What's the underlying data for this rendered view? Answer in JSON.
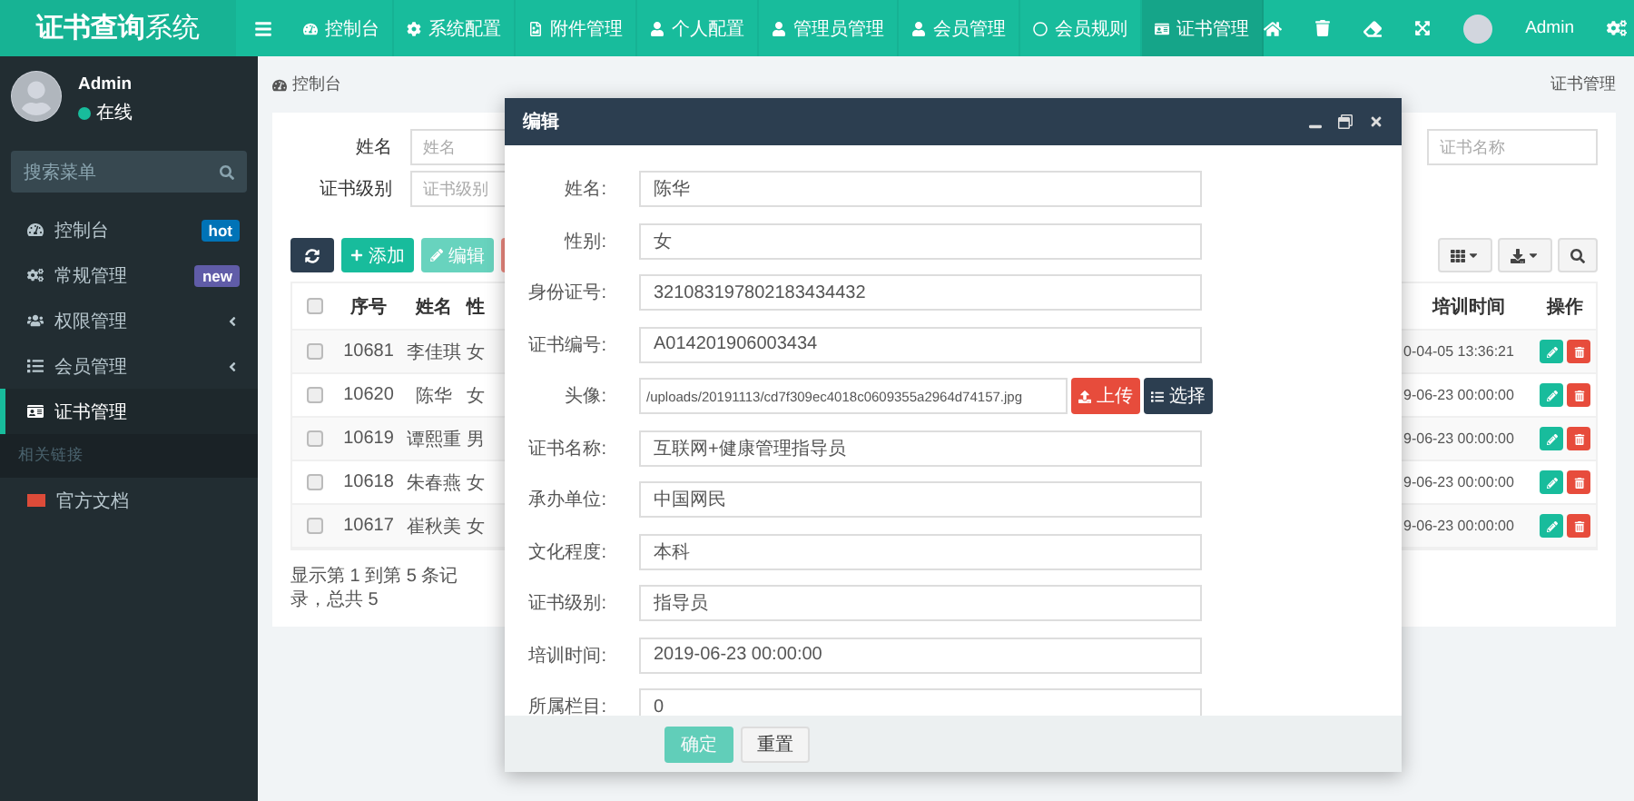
{
  "logo": {
    "bold": "证书查询",
    "light": "系统"
  },
  "topnav": {
    "items": [
      {
        "label": "控制台",
        "selected": false
      },
      {
        "label": "系统配置",
        "selected": false
      },
      {
        "label": "附件管理",
        "selected": false
      },
      {
        "label": "个人配置",
        "selected": false
      },
      {
        "label": "管理员管理",
        "selected": false
      },
      {
        "label": "会员管理",
        "selected": false
      },
      {
        "label": "会员规则",
        "selected": false
      },
      {
        "label": "证书管理",
        "selected": true
      }
    ],
    "user": "Admin"
  },
  "sidebar": {
    "user": {
      "name": "Admin",
      "status": "在线"
    },
    "search": {
      "placeholder": "搜索菜单"
    },
    "items": [
      {
        "label": "控制台",
        "badge": "hot",
        "color": "#0073b7",
        "expandable": false,
        "selected": false
      },
      {
        "label": "常规管理",
        "badge": "new",
        "color": "#605ca8",
        "expandable": false,
        "selected": false
      },
      {
        "label": "权限管理",
        "expandable": true,
        "selected": false
      },
      {
        "label": "会员管理",
        "expandable": true,
        "selected": false
      },
      {
        "label": "证书管理",
        "expandable": false,
        "selected": true
      }
    ],
    "section": "相关链接",
    "links": [
      {
        "label": "官方文档"
      }
    ]
  },
  "breadcrumb": {
    "current": "控制台",
    "right": "证书管理"
  },
  "filters": [
    {
      "label": "姓名",
      "placeholder": "姓名"
    },
    {
      "label": "证书级别",
      "placeholder": "证书级别"
    }
  ],
  "filter_right": {
    "placeholder": "证书名称"
  },
  "toolbar": {
    "buttons": [
      {
        "kind": "refresh",
        "disabled": false
      },
      {
        "kind": "add",
        "label": "添加",
        "disabled": false
      },
      {
        "kind": "edit",
        "label": "编辑",
        "disabled": true
      },
      {
        "kind": "delete",
        "disabled": true
      }
    ]
  },
  "table": {
    "columns": [
      "序号",
      "姓名",
      "性",
      "培训时间",
      "操作"
    ],
    "all_checked": false,
    "rows": [
      {
        "checked": false,
        "cells": [
          "10681",
          "李佳琪",
          "女",
          "0-04-05 13:36:21"
        ]
      },
      {
        "checked": false,
        "cells": [
          "10620",
          "陈华",
          "女",
          "9-06-23 00:00:00"
        ]
      },
      {
        "checked": false,
        "cells": [
          "10619",
          "谭熙重",
          "男",
          "9-06-23 00:00:00"
        ]
      },
      {
        "checked": false,
        "cells": [
          "10618",
          "朱春燕",
          "女",
          "9-06-23 00:00:00"
        ]
      },
      {
        "checked": false,
        "cells": [
          "10617",
          "崔秋美",
          "女",
          "9-06-23 00:00:00"
        ]
      }
    ],
    "footer": "显示第 1 到第 5 条记录，总共 5"
  },
  "modal": {
    "title": "编辑",
    "fields": [
      {
        "label": "姓名:",
        "value": "陈华"
      },
      {
        "label": "性别:",
        "value": "女"
      },
      {
        "label": "身份证号:",
        "value": "321083197802183434432"
      },
      {
        "label": "证书编号:",
        "value": "A014201906003434"
      },
      {
        "label": "头像:",
        "value": "/uploads/20191113/cd7f309ec4018c0609355a2964d74157.jpg",
        "kind": "file",
        "buttons": [
          "上传",
          "选择"
        ]
      },
      {
        "label": "证书名称:",
        "value": "互联网+健康管理指导员"
      },
      {
        "label": "承办单位:",
        "value": "中国网民"
      },
      {
        "label": "文化程度:",
        "value": "本科"
      },
      {
        "label": "证书级别:",
        "value": "指导员"
      },
      {
        "label": "培训时间:",
        "value": "2019-06-23 00:00:00"
      },
      {
        "label": "所属栏目:",
        "value": "0"
      }
    ],
    "buttons": [
      {
        "label": "确定",
        "kind": "primary",
        "disabled": true
      },
      {
        "label": "重置",
        "kind": "default",
        "disabled": false
      }
    ]
  }
}
